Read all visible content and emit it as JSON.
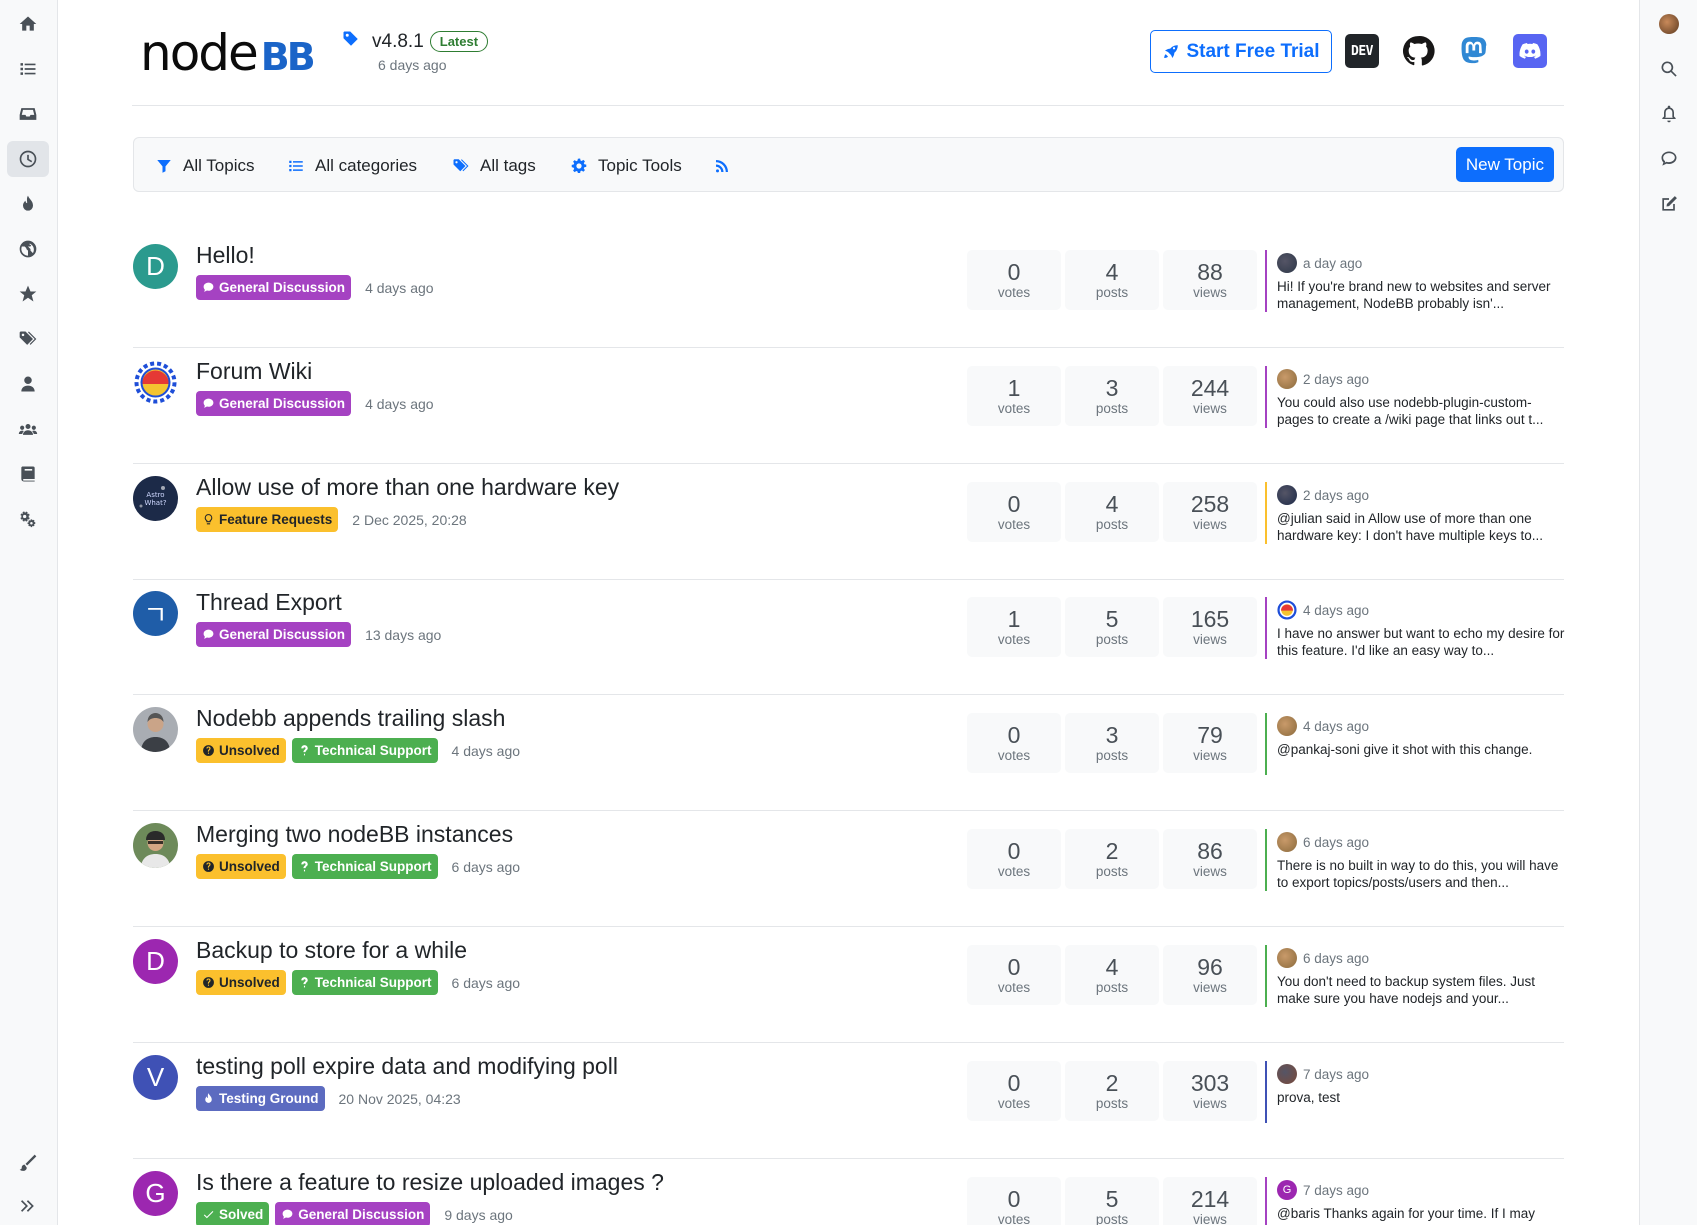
{
  "header": {
    "logo_node": "node",
    "logo_bb": "BB",
    "version": "v4.8.1",
    "latest_label": "Latest",
    "version_date": "6 days ago",
    "trial_label": "Start Free Trial",
    "dev_label": "DEV"
  },
  "toolbar": {
    "all_topics": "All Topics",
    "all_categories": "All categories",
    "all_tags": "All tags",
    "topic_tools": "Topic Tools",
    "new_topic": "New Topic"
  },
  "stat_labels": {
    "votes": "votes",
    "posts": "posts",
    "views": "views"
  },
  "topics": [
    {
      "avatar_letter": "D",
      "avatar_color": "#2b9a8e",
      "title": "Hello!",
      "badges": [
        {
          "label": "General Discussion",
          "color": "#a542c2",
          "icon": "comment-icon"
        }
      ],
      "time": "4 days ago",
      "votes": "0",
      "posts": "4",
      "views": "88",
      "teaser_color": "#a542c2",
      "teaser_time": "a day ago",
      "teaser_text": "Hi! If you're brand new to websites and server management, NodeBB probably isn'..."
    },
    {
      "avatar_letter": "",
      "avatar_color": "#ffffff",
      "title": "Forum Wiki",
      "badges": [
        {
          "label": "General Discussion",
          "color": "#a542c2",
          "icon": "comment-icon"
        }
      ],
      "time": "4 days ago",
      "votes": "1",
      "posts": "3",
      "views": "244",
      "teaser_color": "#a542c2",
      "teaser_time": "2 days ago",
      "teaser_text": "You could also use nodebb-plugin-custom-pages to create a /wiki page that links out t..."
    },
    {
      "avatar_letter": "",
      "avatar_color": "#1c2a48",
      "title": "Allow use of more than one hardware key",
      "badges": [
        {
          "label": "Feature Requests",
          "color": "#fbc02d",
          "icon": "lightbulb-icon",
          "dark": true
        }
      ],
      "time": "2 Dec 2025, 20:28",
      "votes": "0",
      "posts": "4",
      "views": "258",
      "teaser_color": "#fbc02d",
      "teaser_time": "2 days ago",
      "teaser_text": "@julian said in Allow use of more than one hardware key: I don't have multiple keys to..."
    },
    {
      "avatar_letter": "ㄱ",
      "avatar_color": "#1f5da8",
      "title": "Thread Export",
      "badges": [
        {
          "label": "General Discussion",
          "color": "#a542c2",
          "icon": "comment-icon"
        }
      ],
      "time": "13 days ago",
      "votes": "1",
      "posts": "5",
      "views": "165",
      "teaser_color": "#a542c2",
      "teaser_time": "4 days ago",
      "teaser_text": "I have no answer but want to echo my desire for this feature. I'd like an easy way to..."
    },
    {
      "avatar_letter": "",
      "avatar_color": "#8a8f96",
      "title": "Nodebb appends trailing slash",
      "badges": [
        {
          "label": "Unsolved",
          "color": "#fbc02d",
          "icon": "question-circle-icon",
          "dark": true
        },
        {
          "label": "Technical Support",
          "color": "#4caf50",
          "icon": "question-icon"
        }
      ],
      "time": "4 days ago",
      "votes": "0",
      "posts": "3",
      "views": "79",
      "teaser_color": "#4caf50",
      "teaser_time": "4 days ago",
      "teaser_text": "@pankaj-soni give it shot with this change."
    },
    {
      "avatar_letter": "",
      "avatar_color": "#5b6b52",
      "title": "Merging two nodeBB instances",
      "badges": [
        {
          "label": "Unsolved",
          "color": "#fbc02d",
          "icon": "question-circle-icon",
          "dark": true
        },
        {
          "label": "Technical Support",
          "color": "#4caf50",
          "icon": "question-icon"
        }
      ],
      "time": "6 days ago",
      "votes": "0",
      "posts": "2",
      "views": "86",
      "teaser_color": "#4caf50",
      "teaser_time": "6 days ago",
      "teaser_text": "There is no built in way to do this, you will have to export topics/posts/users and then..."
    },
    {
      "avatar_letter": "D",
      "avatar_color": "#9c27b0",
      "title": "Backup to store for a while",
      "badges": [
        {
          "label": "Unsolved",
          "color": "#fbc02d",
          "icon": "question-circle-icon",
          "dark": true
        },
        {
          "label": "Technical Support",
          "color": "#4caf50",
          "icon": "question-icon"
        }
      ],
      "time": "6 days ago",
      "votes": "0",
      "posts": "4",
      "views": "96",
      "teaser_color": "#4caf50",
      "teaser_time": "6 days ago",
      "teaser_text": "You don't need to backup system files. Just make sure you have nodejs and your..."
    },
    {
      "avatar_letter": "V",
      "avatar_color": "#3f51b5",
      "title": "testing poll expire data and modifying poll",
      "badges": [
        {
          "label": "Testing Ground",
          "color": "#5c6bc0",
          "icon": "fire-icon"
        }
      ],
      "time": "20 Nov 2025, 04:23",
      "votes": "0",
      "posts": "2",
      "views": "303",
      "teaser_color": "#3f51b5",
      "teaser_time": "7 days ago",
      "teaser_text": "prova, test"
    },
    {
      "avatar_letter": "G",
      "avatar_color": "#9c27b0",
      "title": "Is there a feature to resize uploaded images ?",
      "badges": [
        {
          "label": "Solved",
          "color": "#4caf50",
          "icon": "check-icon"
        },
        {
          "label": "General Discussion",
          "color": "#a542c2",
          "icon": "comment-icon"
        }
      ],
      "time": "9 days ago",
      "votes": "0",
      "posts": "5",
      "views": "214",
      "teaser_color": "#a542c2",
      "teaser_time": "7 days ago",
      "teaser_text": "@baris Thanks again for your time. If I may"
    }
  ]
}
